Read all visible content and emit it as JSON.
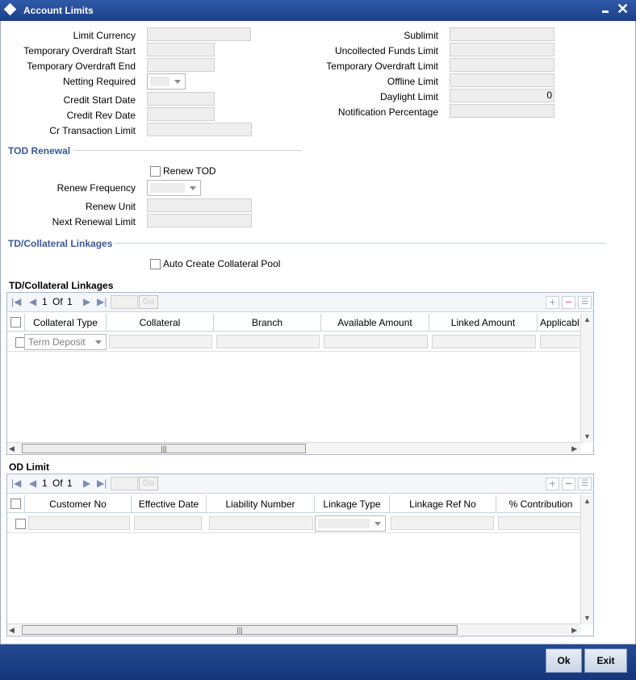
{
  "window": {
    "title": "Account Limits"
  },
  "form_left": [
    {
      "label": "Limit Currency",
      "value": ""
    },
    {
      "label": "Temporary Overdraft Start",
      "value": ""
    },
    {
      "label": "Temporary Overdraft End",
      "value": ""
    },
    {
      "label": "Netting Required",
      "value": ""
    },
    {
      "label": "Credit Start Date",
      "value": ""
    },
    {
      "label": "Credit Rev Date",
      "value": ""
    },
    {
      "label": "Cr Transaction Limit",
      "value": ""
    }
  ],
  "form_right": [
    {
      "label": "Sublimit",
      "value": ""
    },
    {
      "label": "Uncollected Funds Limit",
      "value": ""
    },
    {
      "label": "Temporary Overdraft Limit",
      "value": ""
    },
    {
      "label": "Offline Limit",
      "value": ""
    },
    {
      "label": "Daylight Limit",
      "value": "0"
    },
    {
      "label": "Notification Percentage",
      "value": ""
    }
  ],
  "tod_renewal": {
    "heading": "TOD Renewal",
    "renew_tod_label": "Renew TOD",
    "renew_frequency_label": "Renew Frequency",
    "renew_unit_label": "Renew Unit",
    "next_renewal_limit_label": "Next Renewal Limit"
  },
  "collateral_section": {
    "heading": "TD/Collateral Linkages",
    "auto_create_label": "Auto Create Collateral Pool"
  },
  "collateral_grid": {
    "title": "TD/Collateral Linkages",
    "pager": {
      "current": "1",
      "of_label": "Of",
      "total": "1",
      "go_label": "Go"
    },
    "columns": [
      "Collateral Type",
      "Collateral",
      "Branch",
      "Available Amount",
      "Linked Amount",
      "Applicabl"
    ],
    "rows": [
      {
        "collateral_type": "Term Deposit"
      }
    ]
  },
  "od_grid": {
    "title": "OD Limit",
    "pager": {
      "current": "1",
      "of_label": "Of",
      "total": "1",
      "go_label": "Go"
    },
    "columns": [
      "Customer No",
      "Effective Date",
      "Liability Number",
      "Linkage Type",
      "Linkage Ref No",
      "% Contribution"
    ]
  },
  "footer": {
    "ok_label": "Ok",
    "exit_label": "Exit"
  },
  "colors": {
    "titlebar": "#1b3f86",
    "section_heading": "#3b5998",
    "footer": "#16357a"
  }
}
